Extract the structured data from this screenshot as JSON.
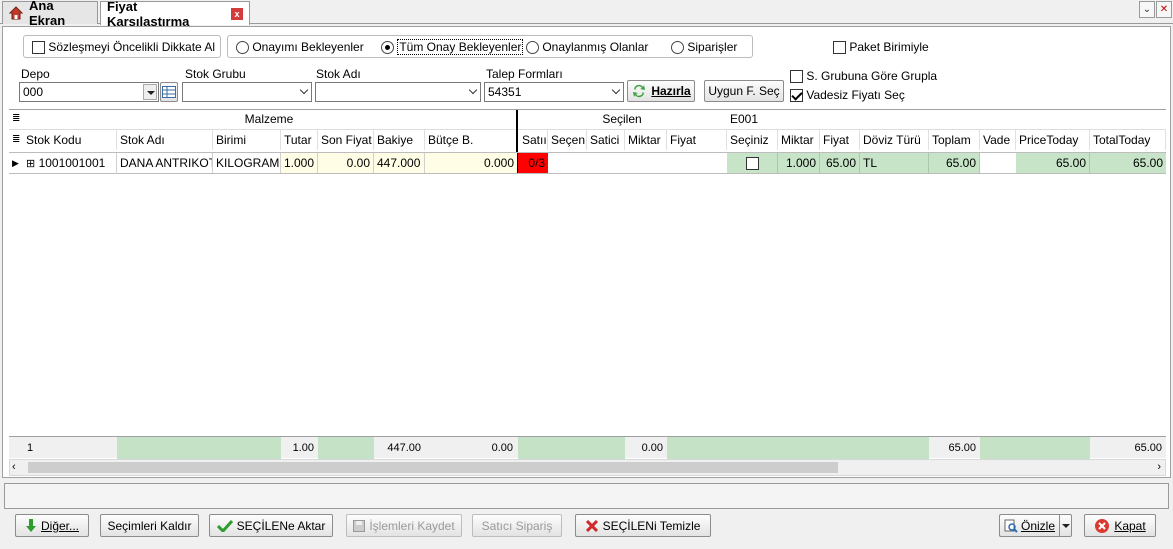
{
  "tabs": [
    {
      "label": "Ana Ekran",
      "icon": "home-icon"
    },
    {
      "label": "Fiyat Karşılaştırma",
      "active": true,
      "close": "x"
    }
  ],
  "window": {
    "dropdown": "⌄",
    "close": "✕"
  },
  "filters": {
    "priority_checkbox": {
      "label": "Sözleşmeyi Öncelikli Dikkate Al",
      "checked": false
    },
    "radios": [
      {
        "label": "Onayımı Bekleyenler",
        "checked": false
      },
      {
        "label": "Tüm Onay Bekleyenler",
        "checked": true
      },
      {
        "label": "Onaylanmış Olanlar",
        "checked": false
      },
      {
        "label": "Siparişler",
        "checked": false
      }
    ],
    "paket_checkbox": {
      "label": "Paket Birimiyle",
      "checked": false
    },
    "depo": {
      "label": "Depo",
      "value": "000"
    },
    "stok_grubu": {
      "label": "Stok Grubu",
      "value": ""
    },
    "stok_adi": {
      "label": "Stok Adı",
      "value": ""
    },
    "talep_formlari": {
      "label": "Talep Formları",
      "value": "54351"
    },
    "hazirla_label": "Hazırla",
    "uygun_label": "Uygun F. Seç",
    "grupla": {
      "label": "S. Grubuna Göre Grupla",
      "checked": false
    },
    "vadesiz": {
      "label": "Vadesiz Fiyatı Seç",
      "checked": true
    }
  },
  "grid": {
    "bands": {
      "malzeme": "Malzeme",
      "secilen": "Seçilen",
      "supplier": "E001"
    },
    "columns": {
      "stok_kodu": "Stok Kodu",
      "stok_adi": "Stok Adı",
      "birimi": "Birimi",
      "tutar": "Tutar",
      "son_fiyat": "Son Fiyat",
      "bakiye": "Bakiye",
      "butce": "Bütçe B.",
      "satir": "Satıı",
      "secen": "Seçen",
      "satici": "Satici",
      "miktar": "Miktar",
      "fiyat": "Fiyat",
      "seciniz": "Seçiniz",
      "s_miktar": "Miktar",
      "s_fiyat": "Fiyat",
      "doviz": "Döviz Türü",
      "toplam": "Toplam",
      "vade": "Vade",
      "price_today": "PriceToday",
      "total_today": "TotalToday"
    },
    "row": {
      "expand": "⊞",
      "stok_kodu": "1001001001",
      "stok_adi": "DANA ANTRIKOT",
      "birimi": "KILOGRAM",
      "tutar": "1.000",
      "son_fiyat": "0.00",
      "bakiye": "447.000",
      "butce": "0.000",
      "satir": "0/3",
      "seciniz_checked": false,
      "s_miktar": "1.000",
      "s_fiyat": "65.00",
      "doviz": "TL",
      "toplam": "65.00",
      "price_today": "65.00",
      "total_today": "65.00"
    },
    "footer": {
      "count": "1",
      "tutar": "1.00",
      "bakiye": "447.00",
      "butce": "0.00",
      "fiyat": "0.00",
      "toplam": "65.00",
      "total_today": "65.00"
    }
  },
  "buttons": {
    "diger": "Diğer...",
    "secimleri_kaldir": "Seçimleri Kaldır",
    "secilene_aktar": "SEÇİLENe Aktar",
    "islemleri_kaydet": "İşlemleri Kaydet",
    "satici_siparis": "Satıcı Sipariş",
    "secileni_temizle": "SEÇİLENi Temizle",
    "onizle": "Önizle",
    "kapat": "Kapat"
  },
  "colors": {
    "accent_red": "#ff0000",
    "row_yellow": "#fffde6",
    "row_green": "#c8e4c8",
    "footer_green": "#c6e2c6"
  }
}
